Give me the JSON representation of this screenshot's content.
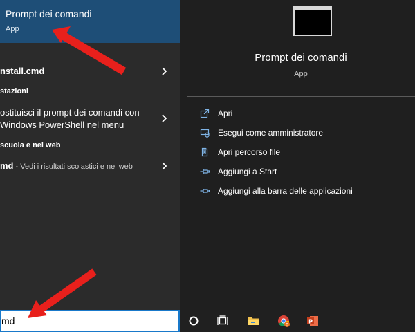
{
  "best_match": {
    "title": "Prompt dei comandi",
    "subtitle": "App"
  },
  "results": [
    {
      "bold": "nstall.cmd",
      "rest": "",
      "sub": ""
    },
    {
      "line1": "ostituisci il prompt dei comandi con",
      "line2": "Windows PowerShell nel menu"
    },
    {
      "bold": "md",
      "rest": "",
      "sub": " - Vedi i risultati scolastici e nel web"
    }
  ],
  "sections": {
    "settings": "stazioni",
    "web": "scuola e nel web"
  },
  "detail": {
    "title": "Prompt dei comandi",
    "subtitle": "App",
    "actions": [
      {
        "label": "Apri",
        "icon": "open-icon"
      },
      {
        "label": "Esegui come amministratore",
        "icon": "admin-shield-icon"
      },
      {
        "label": "Apri percorso file",
        "icon": "file-location-icon"
      },
      {
        "label": "Aggiungi a Start",
        "icon": "pin-icon"
      },
      {
        "label": "Aggiungi alla barra delle applicazioni",
        "icon": "pin-icon"
      }
    ]
  },
  "search": {
    "value": "md"
  },
  "taskbar": {
    "items": [
      "cortana-circle-icon",
      "task-view-icon",
      "file-explorer-icon",
      "chrome-icon",
      "powerpoint-icon"
    ],
    "chrome_badge": "0",
    "powerpoint_letter": "P"
  },
  "colors": {
    "accent": "#1e4e77",
    "search_border": "#1979ca",
    "arrow": "#e8201c"
  }
}
